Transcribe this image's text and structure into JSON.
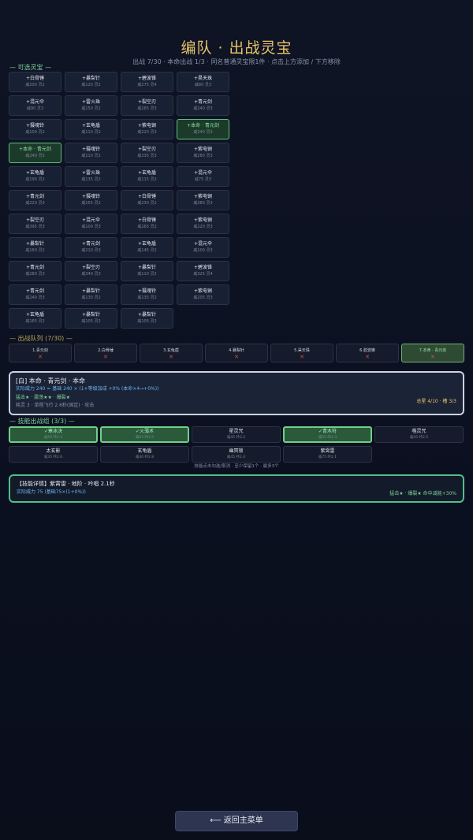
{
  "header": {
    "title": "编队 · 出战灵宝",
    "subtitle": "出战 7/30 · 本命出战 1/3 · 同名普通灵宝限1件 · 点击上方添加 / 下方移除"
  },
  "pool_label": "— 可选灵宝 —",
  "pool": [
    {
      "name": "+白骨锤",
      "stats": "威200 灵2"
    },
    {
      "name": "+暴梨针",
      "stats": "威120 灵2"
    },
    {
      "name": "+碧波锥",
      "stats": "威275 灵4"
    },
    {
      "name": "+昊天珠",
      "stats": "威80 灵3"
    },
    {
      "name": "+混元伞",
      "stats": "威90 灵3"
    },
    {
      "name": "+雷火珠",
      "stats": "威150 灵2"
    },
    {
      "name": "+裂空刃",
      "stats": "威265 灵3"
    },
    {
      "name": "+青元剑",
      "stats": "威240 灵3"
    },
    {
      "name": "+摄魂铃",
      "stats": "威100 灵2"
    },
    {
      "name": "+玄龟盾",
      "stats": "威110 灵2"
    },
    {
      "name": "+紫电锏",
      "stats": "威220 灵3"
    },
    {
      "name": "+本命 · 青元剑",
      "stats": "威240 灵3",
      "selected": true
    },
    {
      "name": "+本命 · 青元剑",
      "stats": "威240 灵3",
      "selected": true
    },
    {
      "name": "+摄魂铃",
      "stats": "威110 灵2"
    },
    {
      "name": "+裂空刃",
      "stats": "威335 灵3"
    },
    {
      "name": "+紫电锏",
      "stats": "威280 灵3"
    },
    {
      "name": "+玄龟盾",
      "stats": "威190 灵2"
    },
    {
      "name": "+雷火珠",
      "stats": "威135 灵2"
    },
    {
      "name": "+玄龟盾",
      "stats": "威115 灵2"
    },
    {
      "name": "+混元伞",
      "stats": "威75 灵3"
    },
    {
      "name": "+青元剑",
      "stats": "威220 灵3"
    },
    {
      "name": "+摄魂铃",
      "stats": "威155 灵2"
    },
    {
      "name": "+白骨锤",
      "stats": "威230 灵2"
    },
    {
      "name": "+紫电锏",
      "stats": "威380 灵3"
    },
    {
      "name": "+裂空刃",
      "stats": "威395 灵3"
    },
    {
      "name": "+混元伞",
      "stats": "威100 灵3"
    },
    {
      "name": "+白骨锤",
      "stats": "威265 灵2"
    },
    {
      "name": "+紫电锏",
      "stats": "威220 灵3"
    },
    {
      "name": "+暴梨针",
      "stats": "威160 灵2"
    },
    {
      "name": "+青元剑",
      "stats": "威210 灵3"
    },
    {
      "name": "+玄龟盾",
      "stats": "威145 灵2"
    },
    {
      "name": "+混元伞",
      "stats": "威100 灵3"
    },
    {
      "name": "+青元剑",
      "stats": "威280 灵3"
    },
    {
      "name": "+裂空刃",
      "stats": "威340 灵3"
    },
    {
      "name": "+暴梨针",
      "stats": "威110 灵2"
    },
    {
      "name": "+碧波锥",
      "stats": "威325 灵4"
    },
    {
      "name": "+青元剑",
      "stats": "威240 灵3"
    },
    {
      "name": "+暴梨针",
      "stats": "威130 灵2"
    },
    {
      "name": "+摄魂铃",
      "stats": "威135 灵2"
    },
    {
      "name": "+紫电锏",
      "stats": "威205 灵3"
    },
    {
      "name": "+玄龟盾",
      "stats": "威165 灵2"
    },
    {
      "name": "+暴梨针",
      "stats": "威105 灵2"
    },
    {
      "name": "+暴梨针",
      "stats": "威105 灵2"
    }
  ],
  "team_label": "— 出战队列 (7/30) —",
  "team": [
    {
      "name": "1.青元剑",
      "remove": "✕"
    },
    {
      "name": "2.白骨锤",
      "remove": "✕"
    },
    {
      "name": "3.玄龟盾",
      "remove": "✕"
    },
    {
      "name": "4.暴梨针",
      "remove": "✕"
    },
    {
      "name": "5.昊天珠",
      "remove": "✕"
    },
    {
      "name": "6.碧波锥",
      "remove": "✕"
    },
    {
      "name": "7.本命 · 青元剑",
      "remove": "✕",
      "selected": true
    }
  ],
  "info": {
    "line1": "[白] 本命 · 青元剑 · 本命",
    "line2": "实际威力 240 = 基础 240 × (1+等级加成 +0% (本命×4→+0%))",
    "line3": "猛击★ · 震荡★★ · 爆裂★",
    "line4": "耗灵 3 · 单程飞行 2.6秒(固定) · 攻击",
    "right": "总星 4/10 · 槽 3/3"
  },
  "skills_label": "— 技能出战组 (3/3) —",
  "skills": [
    {
      "name": "✓寒冰决",
      "stats": "威50 吟2.4",
      "selected": true
    },
    {
      "name": "✓火薄术",
      "stats": "威63 吟2.5",
      "selected": true
    },
    {
      "name": "星灵咒",
      "stats": "威45 吟2.2"
    },
    {
      "name": "✓青木符",
      "stats": "威55 吟2.3",
      "selected": true
    },
    {
      "name": "噬灵咒",
      "stats": "威45 吟2.5"
    },
    {
      "name": "太玄影",
      "stats": "威35 吟2.6"
    },
    {
      "name": "玄龟盾",
      "stats": "威40 吟2.8"
    },
    {
      "name": "幽冥锁",
      "stats": "威45 吟2.4"
    },
    {
      "name": "紫霄雷",
      "stats": "威75 吟2.1"
    }
  ],
  "skills_hint": "技能点击勾选/取消 · 至少保留1个 · 最多3个",
  "detail": {
    "line1": "【技能详情】紫霄雷 · 地阶 · 吟唱 2.1秒",
    "line2": "实际威力 75 (基础75×(1+0%))",
    "right": "猛击★ · 爆裂★ 命中减能+30%"
  },
  "back_button": "⟵ 返回主菜单",
  "colors": {
    "accent_gold": "#e8c36a",
    "selected_green": "#5fc07e",
    "remove_red": "#d54b4b"
  }
}
